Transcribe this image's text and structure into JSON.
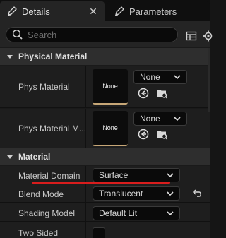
{
  "tabs": [
    {
      "label": "Details",
      "icon": "pencil-icon",
      "active": true,
      "close": "✕"
    },
    {
      "label": "Parameters",
      "icon": "pencil-icon",
      "active": false
    }
  ],
  "search": {
    "placeholder": "Search",
    "value": ""
  },
  "toolbar_icons": [
    "table-view-icon",
    "settings-gear-icon"
  ],
  "sections": [
    {
      "title": "Physical Material",
      "rows": [
        {
          "label": "Phys Material",
          "thumb_text": "None",
          "value": "None"
        },
        {
          "label": "Phys Material M...",
          "thumb_text": "None",
          "value": "None"
        }
      ]
    },
    {
      "title": "Material",
      "rows": [
        {
          "label": "Material Domain",
          "value": "Surface"
        },
        {
          "label": "Blend Mode",
          "value": "Translucent"
        },
        {
          "label": "Shading Model",
          "value": "Default Lit"
        },
        {
          "label": "Two Sided",
          "checked": false
        }
      ]
    }
  ],
  "colors": {
    "thumb_accent": "#c7a777",
    "annotation": "#d81d1d",
    "panel_bg": "#1e1e1e",
    "header_bg": "#2e2e2e"
  }
}
